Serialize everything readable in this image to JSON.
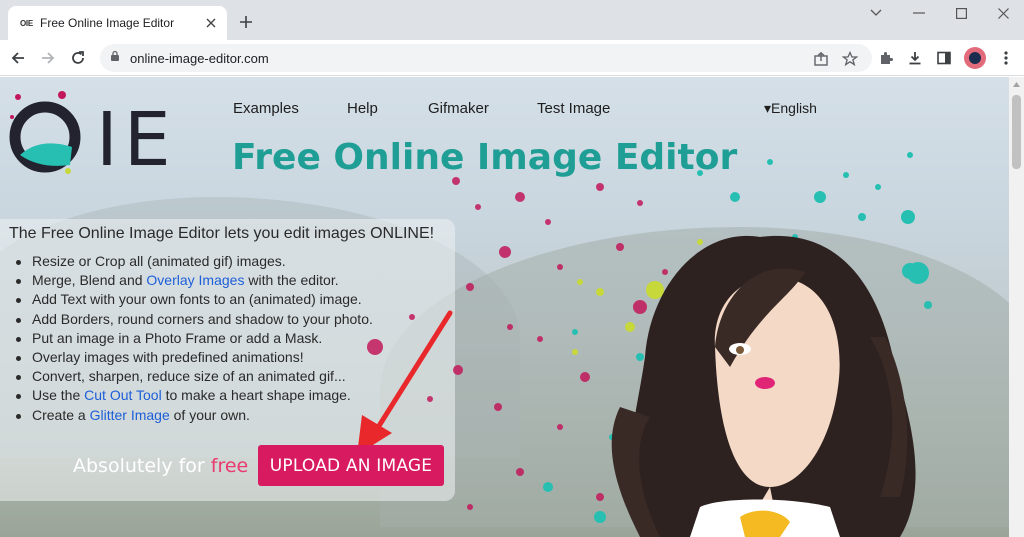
{
  "browser": {
    "tab_title": "Free Online Image Editor",
    "tab_favicon": "OIE",
    "url": "online-image-editor.com"
  },
  "site": {
    "logo_text": "IE",
    "nav": [
      "Examples",
      "Help",
      "Gifmaker",
      "Test Image"
    ],
    "language": "▾English",
    "headline": "Free Online Image Editor",
    "intro": "The Free Online Image Editor lets you edit images ONLINE!",
    "features": [
      {
        "pre": "Resize or Crop all (animated gif) images.",
        "link": "",
        "post": ""
      },
      {
        "pre": "Merge, Blend and ",
        "link": "Overlay Images",
        "post": " with the editor."
      },
      {
        "pre": "Add Text with your own fonts to an (animated) image.",
        "link": "",
        "post": ""
      },
      {
        "pre": "Add Borders, round corners and shadow to your photo.",
        "link": "",
        "post": ""
      },
      {
        "pre": "Put an image in a Photo Frame or add a Mask.",
        "link": "",
        "post": ""
      },
      {
        "pre": "Overlay images with predefined animations!",
        "link": "",
        "post": ""
      },
      {
        "pre": "Convert, sharpen, reduce size of an animated gif...",
        "link": "",
        "post": ""
      },
      {
        "pre": "Use the ",
        "link": "Cut Out Tool",
        "post": " to make a heart shape image."
      },
      {
        "pre": "Create a ",
        "link": "Glitter Image",
        "post": " of your own."
      }
    ],
    "free_prefix": "Absolutely for ",
    "free_word": "free",
    "upload_label": "UPLOAD AN IMAGE"
  },
  "colors": {
    "headline": "#1f9e95",
    "upload_button": "#d81b60",
    "link": "#1d5fd8",
    "arrow": "#e8282b"
  }
}
